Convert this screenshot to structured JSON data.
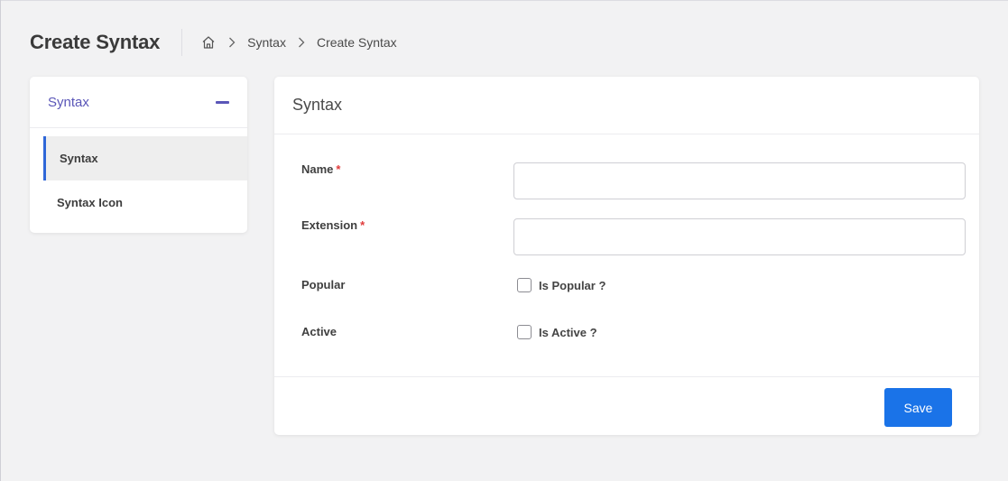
{
  "header": {
    "title": "Create Syntax",
    "breadcrumb": {
      "home_icon": "home-icon",
      "items": [
        "Syntax",
        "Create Syntax"
      ]
    }
  },
  "sidebar": {
    "section_label": "Syntax",
    "collapse_icon": "minus-icon",
    "items": [
      {
        "label": "Syntax",
        "active": true
      },
      {
        "label": "Syntax Icon",
        "active": false
      }
    ]
  },
  "form": {
    "title": "Syntax",
    "fields": {
      "name": {
        "label": "Name",
        "required_mark": "*",
        "value": ""
      },
      "extension": {
        "label": "Extension",
        "required_mark": "*",
        "value": ""
      },
      "popular": {
        "label": "Popular",
        "checkbox_label": "Is Popular ?",
        "checked": false
      },
      "active": {
        "label": "Active",
        "checkbox_label": "Is Active ?",
        "checked": false
      }
    },
    "save_label": "Save"
  },
  "colors": {
    "accent": "#5a56b8",
    "primary_button": "#1a73e8",
    "active_indicator": "#2f67d8",
    "required": "#e03b3b"
  }
}
